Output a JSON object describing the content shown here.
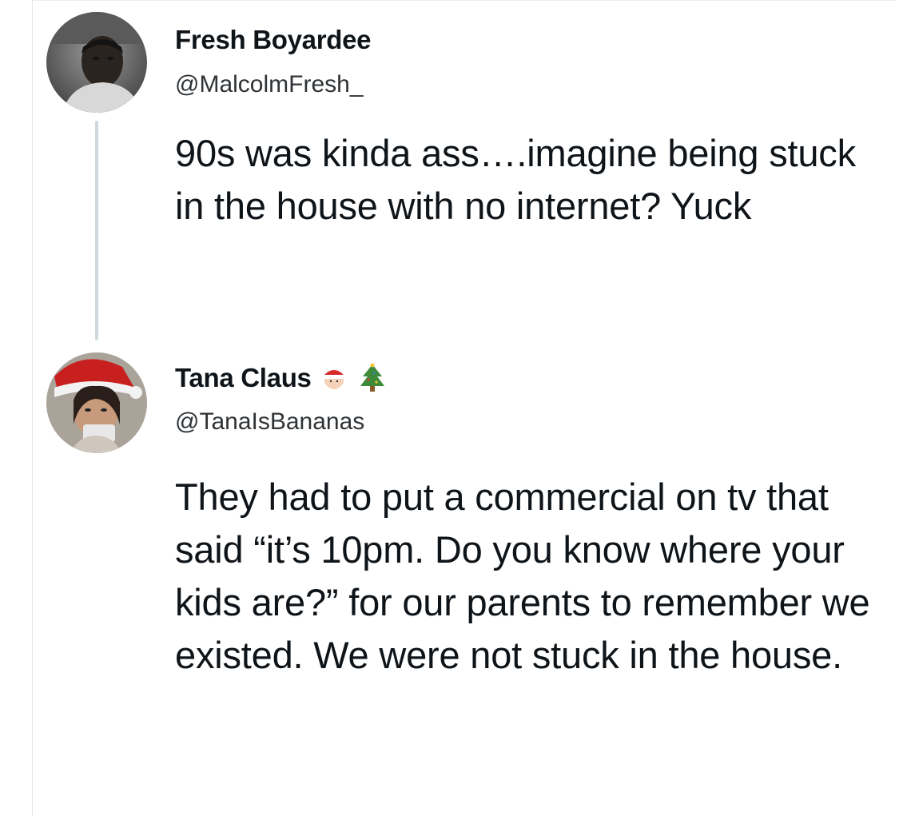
{
  "thread": {
    "original_tweet": {
      "display_name": "Fresh Boyardee",
      "handle": "@MalcolmFresh_",
      "text": "90s was kinda ass….imagine being stuck in the house with no internet? Yuck",
      "avatar_icon": "user-photo-avatar"
    },
    "reply_tweet": {
      "display_name": "Tana Claus",
      "name_emojis": [
        "santa-emoji-icon",
        "christmas-tree-emoji-icon"
      ],
      "handle": "@TanaIsBananas",
      "text": "They had to put a commercial on tv that said “it’s 10pm. Do you know where your kids are?” for our parents to remember we existed. We were not stuck in the house.",
      "avatar_icon": "user-photo-avatar"
    }
  },
  "colors": {
    "text_primary": "#0f1419",
    "text_secondary": "#2f3336",
    "thread_line": "#cfd9de",
    "background": "#ffffff"
  }
}
